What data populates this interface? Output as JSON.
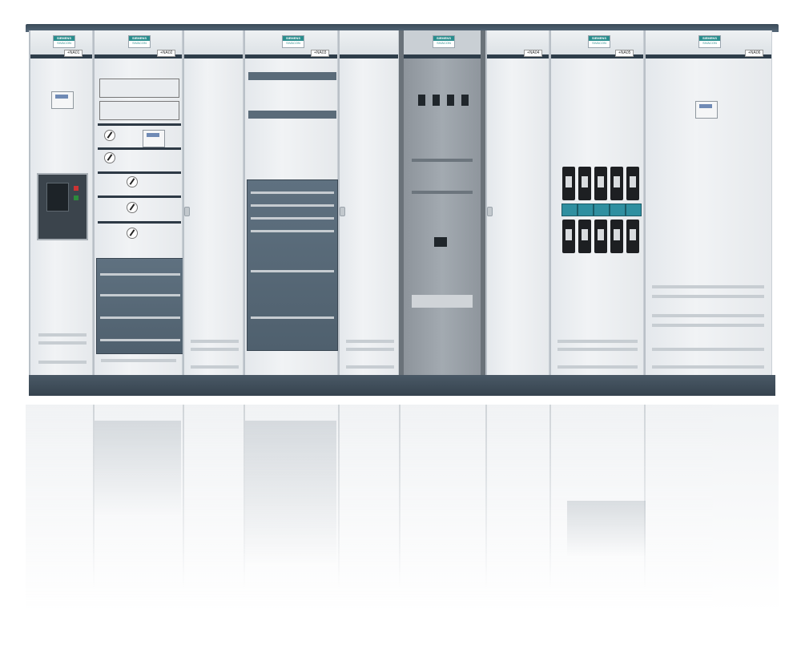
{
  "scene": {
    "subject": "",
    "colors": {
      "cabinet": "#e8ecef",
      "roof": "#3e4e5c",
      "plinth": "#3e4b57",
      "module": "#56697a",
      "logo_teal": "#2a8d8d",
      "fuse_teal": "#2f8fa0"
    }
  },
  "cabinets": [
    {
      "brand": "SIEMENS",
      "product": "SIVACON",
      "tag": "+NA01"
    },
    {
      "brand": "SIEMENS",
      "product": "SIVACON",
      "tag": "+NA02"
    },
    {
      "brand": "SIEMENS",
      "product": "SIVACON",
      "tag": "+NA03"
    },
    {
      "brand": "SIEMENS",
      "product": "SIVACON",
      "tag": ""
    },
    {
      "brand": "SIEMENS",
      "product": "SIVACON",
      "tag": "+NA04"
    },
    {
      "brand": "SIEMENS",
      "product": "SIVACON",
      "tag": "+NA05"
    },
    {
      "brand": "SIEMENS",
      "product": "SIVACON",
      "tag": "+NA06"
    }
  ]
}
